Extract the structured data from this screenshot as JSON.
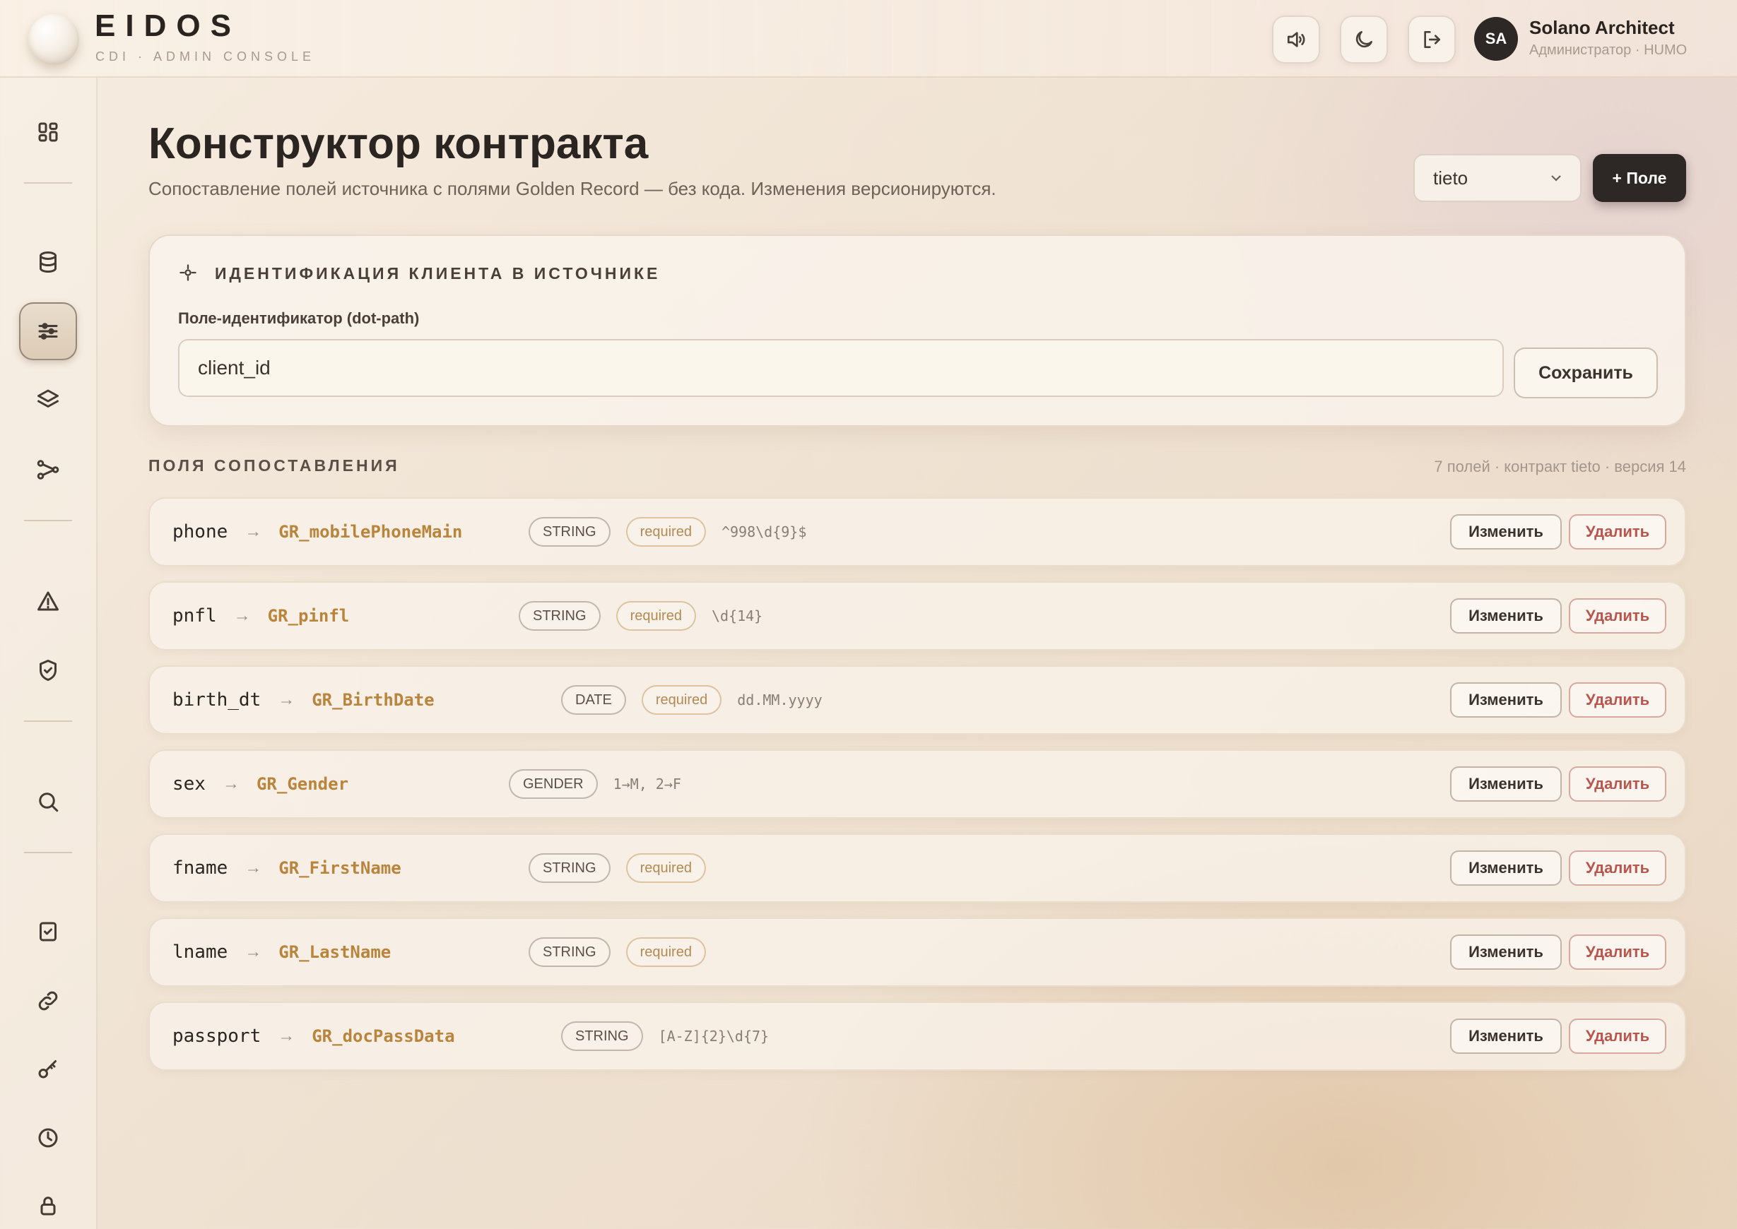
{
  "brand": {
    "name": "EIDOS",
    "subtitle": "CDI · ADMIN CONSOLE"
  },
  "header": {
    "buttons": [
      {
        "icon": "speaker-icon"
      },
      {
        "icon": "moon-icon"
      },
      {
        "icon": "logout-icon"
      }
    ],
    "user": {
      "initials": "SA",
      "name": "Solano Architect",
      "role": "Администратор · HUMO"
    }
  },
  "sidebar": {
    "items": [
      {
        "icon": "dashboard-icon"
      },
      {
        "icon": "database-icon"
      },
      {
        "icon": "sliders-icon",
        "active": true
      },
      {
        "icon": "layers-icon"
      },
      {
        "icon": "pipeline-icon"
      },
      {
        "icon": "warning-icon"
      },
      {
        "icon": "shield-icon"
      },
      {
        "icon": "search-icon"
      },
      {
        "icon": "checklist-icon"
      },
      {
        "icon": "link-icon"
      },
      {
        "icon": "key-icon"
      },
      {
        "icon": "clock-icon"
      },
      {
        "icon": "lock-icon"
      }
    ]
  },
  "page": {
    "title": "Конструктор контракта",
    "subtitle": "Сопоставление полей источника с полями Golden Record — без кода. Изменения версионируются.",
    "source_select": "tieto",
    "add_field_label": "+ Поле"
  },
  "identity": {
    "title": "ИДЕНТИФИКАЦИЯ КЛИЕНТА В ИСТОЧНИКЕ",
    "field_label": "Поле-идентификатор (dot-path)",
    "field_value": "client_id",
    "save_label": "Сохранить"
  },
  "mapping": {
    "title": "ПОЛЯ СОПОСТАВЛЕНИЯ",
    "meta": "7 полей · контракт tieto · версия 14",
    "edit_label": "Изменить",
    "delete_label": "Удалить",
    "rows": [
      {
        "source": "phone",
        "target": "GR_mobilePhoneMain",
        "type": "STRING",
        "required": "required",
        "pattern": "^998\\d{9}$"
      },
      {
        "source": "pnfl",
        "target": "GR_pinfl",
        "type": "STRING",
        "required": "required",
        "pattern": "\\d{14}"
      },
      {
        "source": "birth_dt",
        "target": "GR_BirthDate",
        "type": "DATE",
        "required": "required",
        "pattern": "dd.MM.yyyy"
      },
      {
        "source": "sex",
        "target": "GR_Gender",
        "type": "GENDER",
        "required": "",
        "pattern": "1→M, 2→F"
      },
      {
        "source": "fname",
        "target": "GR_FirstName",
        "type": "STRING",
        "required": "required",
        "pattern": ""
      },
      {
        "source": "lname",
        "target": "GR_LastName",
        "type": "STRING",
        "required": "required",
        "pattern": ""
      },
      {
        "source": "passport",
        "target": "GR_docPassData",
        "type": "STRING",
        "required": "",
        "pattern": "[A-Z]{2}\\d{7}"
      }
    ]
  }
}
